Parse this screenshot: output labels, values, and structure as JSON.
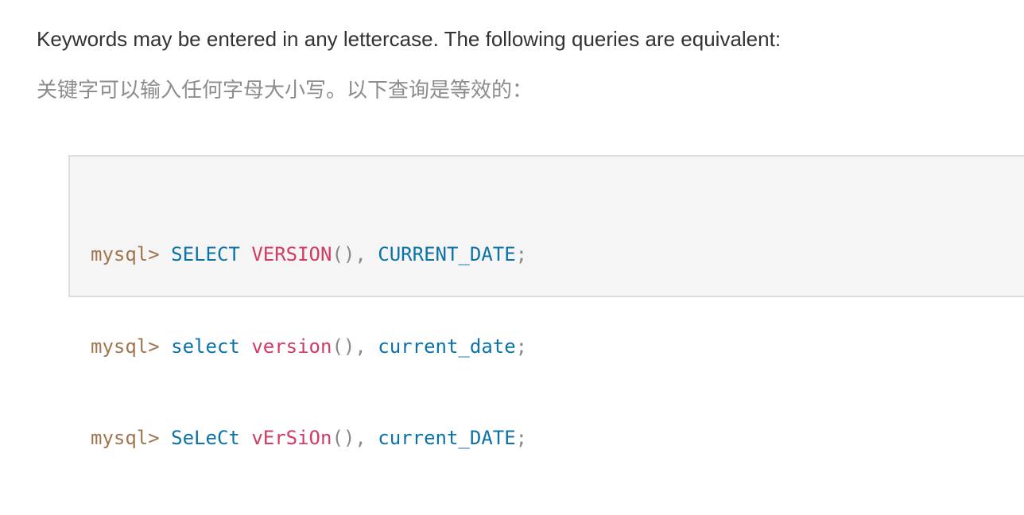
{
  "text": {
    "en": "Keywords may be entered in any lettercase. The following queries are equivalent:",
    "zh": "关键字可以输入任何字母大小写。以下查询是等效的："
  },
  "code": {
    "lines": [
      {
        "prompt": "mysql>",
        "kw": "SELECT",
        "fn": "VERSION",
        "parens": "()",
        "comma": ",",
        "ident": "CURRENT_DATE",
        "semi": ";"
      },
      {
        "prompt": "mysql>",
        "kw": "select",
        "fn": "version",
        "parens": "()",
        "comma": ",",
        "ident": "current_date",
        "semi": ";"
      },
      {
        "prompt": "mysql>",
        "kw": "SeLeCt",
        "fn": "vErSiOn",
        "parens": "()",
        "comma": ",",
        "ident": "current_DATE",
        "semi": ";"
      }
    ]
  },
  "colors": {
    "prompt": "#a0764f",
    "keyword": "#0b72a8",
    "function": "#d23b62",
    "punctuation": "#888888",
    "code_background": "#f5f5f5",
    "code_border": "#dddddd"
  }
}
